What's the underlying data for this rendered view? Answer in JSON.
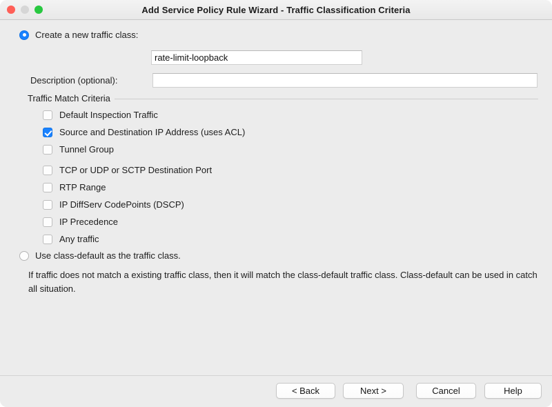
{
  "window": {
    "title": "Add Service Policy Rule Wizard - Traffic Classification Criteria",
    "controls": {
      "close": "close-button",
      "minimize": "minimize-button",
      "zoom": "zoom-button"
    }
  },
  "form": {
    "create_class": {
      "label": "Create a new traffic class:",
      "selected": true,
      "value": "rate-limit-loopback",
      "placeholder": ""
    },
    "description": {
      "label": "Description (optional):",
      "value": "",
      "placeholder": ""
    },
    "group": {
      "title": "Traffic Match Criteria",
      "options": [
        {
          "label": "Default Inspection Traffic",
          "checked": false,
          "gap_above": false
        },
        {
          "label": "Source and Destination IP Address (uses ACL)",
          "checked": true,
          "gap_above": false
        },
        {
          "label": "Tunnel Group",
          "checked": false,
          "gap_above": false
        },
        {
          "label": "TCP or UDP or SCTP Destination Port",
          "checked": false,
          "gap_above": true
        },
        {
          "label": "RTP Range",
          "checked": false,
          "gap_above": false
        },
        {
          "label": "IP DiffServ CodePoints (DSCP)",
          "checked": false,
          "gap_above": false
        },
        {
          "label": "IP Precedence",
          "checked": false,
          "gap_above": false
        },
        {
          "label": "Any traffic",
          "checked": false,
          "gap_above": false
        }
      ]
    },
    "use_class_default": {
      "label": "Use class-default as the traffic class.",
      "selected": false,
      "note": "If traffic does not match a existing traffic class, then it will match the class-default traffic class. Class-default can be used in catch all situation."
    }
  },
  "footer": {
    "back": "< Back",
    "next": "Next >",
    "cancel": "Cancel",
    "help": "Help"
  },
  "colors": {
    "accent": "#1a82ff",
    "window_bg": "#ececec",
    "close": "#ff5f57",
    "minimize": "#d6d6d6",
    "zoom": "#28c840"
  }
}
